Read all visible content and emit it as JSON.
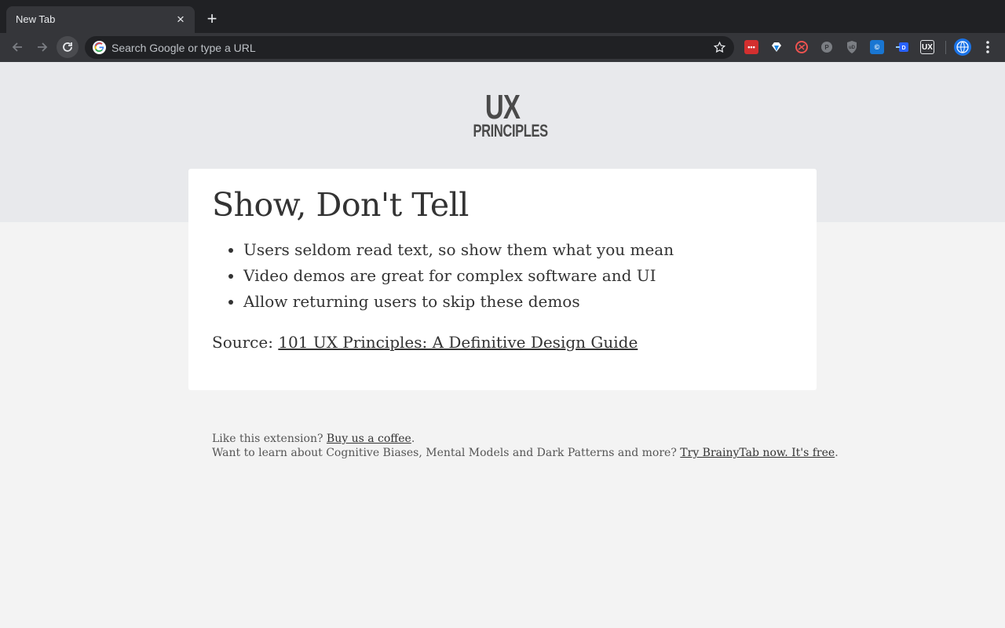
{
  "browser": {
    "tab_title": "New Tab",
    "omnibox_placeholder": "Search Google or type a URL",
    "extensions": [
      "lastpass-icon",
      "diamond-icon",
      "lens-icon",
      "pocket-icon",
      "ublock-icon",
      "extension-blue-icon",
      "extension-dict-icon",
      "ux-principles-icon"
    ]
  },
  "page": {
    "logo_line1": "UX",
    "logo_line2": "PRINCIPLES",
    "card": {
      "title": "Show, Don't Tell",
      "points": [
        "Users seldom read text, so show them what you mean",
        "Video demos are great for complex software and UI",
        "Allow returning users to skip these demos"
      ],
      "source_prefix": "Source: ",
      "source_link": "101 UX Principles: A Definitive Design Guide"
    },
    "footer": {
      "line1_text": "Like this extension? ",
      "line1_link": "Buy us a coffee",
      "line1_end": ".",
      "line2_text": "Want to learn about Cognitive Biases, Mental Models and Dark Patterns and more? ",
      "line2_link": "Try BrainyTab now. It's free",
      "line2_end": "."
    }
  }
}
